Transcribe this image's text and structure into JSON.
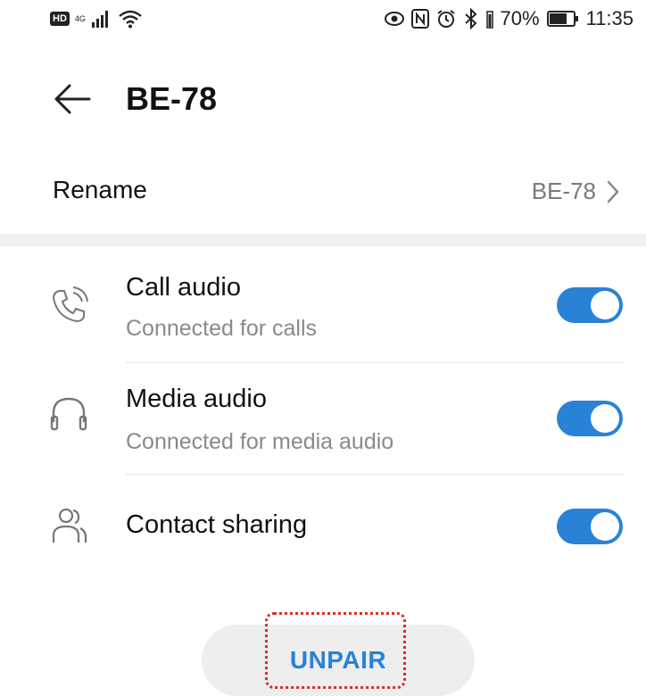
{
  "status_bar": {
    "hd_badge": "HD",
    "network": "4G",
    "battery_percent": "70%",
    "time": "11:35",
    "icons": [
      "signal-icon",
      "wifi-icon",
      "eye-icon",
      "nfc-icon",
      "alarm-icon",
      "bluetooth-icon",
      "battery-icon"
    ]
  },
  "header": {
    "back_icon": "arrow-left-icon",
    "title": "BE-78"
  },
  "rename": {
    "label": "Rename",
    "value": "BE-78",
    "icon": "chevron-right-icon"
  },
  "profiles": [
    {
      "icon": "phone-icon",
      "title": "Call audio",
      "subtitle": "Connected for calls",
      "enabled": true
    },
    {
      "icon": "headphones-icon",
      "title": "Media audio",
      "subtitle": "Connected for media audio",
      "enabled": true
    },
    {
      "icon": "contacts-icon",
      "title": "Contact sharing",
      "enabled": true
    }
  ],
  "unpair_button": {
    "label": "UNPAIR"
  },
  "colors": {
    "accent": "#2a82d6",
    "highlight": "#d62d2d",
    "divider": "#e5e5e5"
  }
}
